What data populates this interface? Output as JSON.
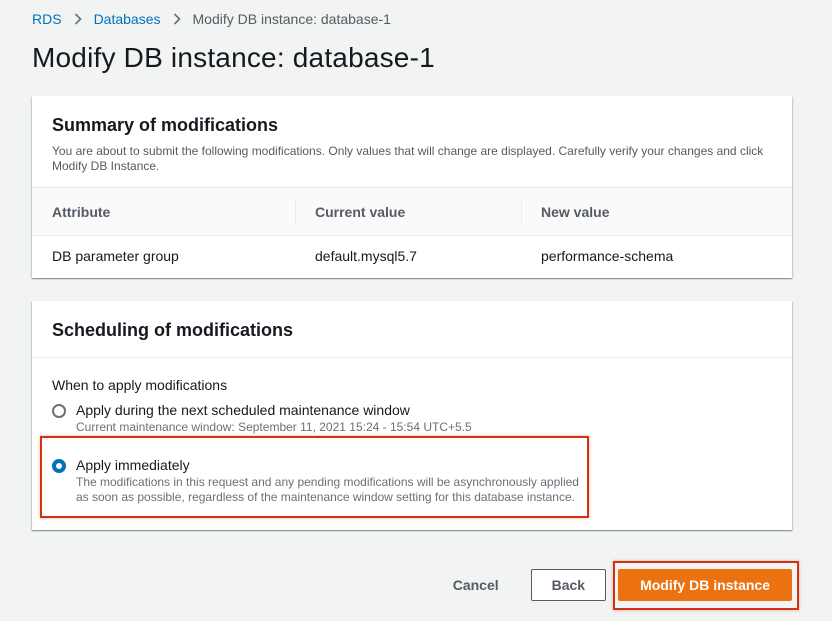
{
  "breadcrumb": {
    "items": [
      "RDS",
      "Databases"
    ],
    "current": "Modify DB instance: database-1"
  },
  "page": {
    "title": "Modify DB instance: database-1"
  },
  "summary": {
    "title": "Summary of modifications",
    "description": "You are about to submit the following modifications. Only values that will change are displayed. Carefully verify your changes and click Modify DB Instance.",
    "columns": [
      "Attribute",
      "Current value",
      "New value"
    ],
    "rows": [
      {
        "attribute": "DB parameter group",
        "current": "default.mysql5.7",
        "new": "performance-schema"
      }
    ]
  },
  "scheduling": {
    "title": "Scheduling of modifications",
    "field_label": "When to apply modifications",
    "options": [
      {
        "label": "Apply during the next scheduled maintenance window",
        "description": "Current maintenance window: September 11, 2021 15:24 - 15:54 UTC+5.5",
        "checked": false
      },
      {
        "label": "Apply immediately",
        "description": "The modifications in this request and any pending modifications will be asynchronously applied as soon as possible, regardless of the maintenance window setting for this database instance.",
        "checked": true
      }
    ]
  },
  "footer": {
    "cancel_label": "Cancel",
    "back_label": "Back",
    "submit_label": "Modify DB instance"
  },
  "colors": {
    "link": "#0073bb",
    "primary": "#ec7211",
    "highlight": "#d13212"
  },
  "icons": {
    "breadcrumb_separator": "chevron-right-icon"
  }
}
